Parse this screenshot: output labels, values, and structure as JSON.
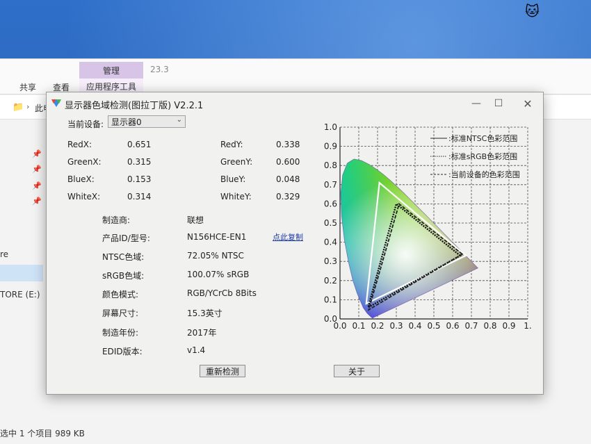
{
  "explorer": {
    "ribbon_manage_tab": "管理",
    "ribbon_version_label": "23.3",
    "ribbon_tabs": [
      "共享",
      "查看"
    ],
    "ribbon_active_tab": "应用程序工具",
    "breadcrumb_partial": "此电",
    "sidebar_partial_1": "re",
    "drive_label": "TORE (E:)",
    "status_text": "选中 1 个项目  989 KB"
  },
  "dialog": {
    "title": "显示器色域检测(图拉丁版) V2.2.1",
    "device_label": "当前设备:",
    "device_value": "显示器0",
    "coords": [
      {
        "label": "RedX:",
        "value": "0.651"
      },
      {
        "label": "RedY:",
        "value": "0.338"
      },
      {
        "label": "GreenX:",
        "value": "0.315"
      },
      {
        "label": "GreenY:",
        "value": "0.600"
      },
      {
        "label": "BlueX:",
        "value": "0.153"
      },
      {
        "label": "BlueY:",
        "value": "0.048"
      },
      {
        "label": "WhiteX:",
        "value": "0.314"
      },
      {
        "label": "WhiteY:",
        "value": "0.329"
      }
    ],
    "info": [
      {
        "label": "制造商:",
        "value": "联想"
      },
      {
        "label": "产品ID/型号:",
        "value": "N156HCE-EN1"
      },
      {
        "label": "NTSC色域:",
        "value": "72.05% NTSC"
      },
      {
        "label": "sRGB色域:",
        "value": "100.07% sRGB"
      },
      {
        "label": "颜色模式:",
        "value": "RGB/YCrCb 8Bits"
      },
      {
        "label": "屏幕尺寸:",
        "value": "15.3英寸"
      },
      {
        "label": "制造年份:",
        "value": "2017年"
      },
      {
        "label": "EDID版本:",
        "value": "v1.4"
      }
    ],
    "copy_link": "点此复制",
    "redetect_button": "重新检测",
    "about_button": "关于"
  },
  "chart_data": {
    "type": "scatter",
    "title": "",
    "xlabel": "",
    "ylabel": "",
    "xlim": [
      0,
      1.0
    ],
    "ylim": [
      0,
      1.0
    ],
    "x_ticks": [
      "0.0",
      "0.1",
      "0.2",
      "0.3",
      "0.4",
      "0.5",
      "0.6",
      "0.7",
      "0.8",
      "0.9",
      "1."
    ],
    "y_ticks": [
      "0.0",
      "0.1",
      "0.2",
      "0.3",
      "0.4",
      "0.5",
      "0.6",
      "0.7",
      "0.8",
      "0.9",
      "1.0"
    ],
    "grid": true,
    "legend_position": "top-right",
    "legend": [
      "标准NTSC色彩范围",
      "标准sRGB色彩范围",
      "当前设备的色彩范围"
    ],
    "series": [
      {
        "name": "标准NTSC色彩范围",
        "points": [
          [
            0.67,
            0.33
          ],
          [
            0.21,
            0.71
          ],
          [
            0.14,
            0.08
          ]
        ]
      },
      {
        "name": "标准sRGB色彩范围",
        "points": [
          [
            0.64,
            0.33
          ],
          [
            0.3,
            0.6
          ],
          [
            0.15,
            0.06
          ]
        ]
      },
      {
        "name": "当前设备的色彩范围",
        "points": [
          [
            0.651,
            0.338
          ],
          [
            0.315,
            0.6
          ],
          [
            0.153,
            0.048
          ]
        ]
      }
    ],
    "white_point": [
      0.314,
      0.329
    ]
  }
}
